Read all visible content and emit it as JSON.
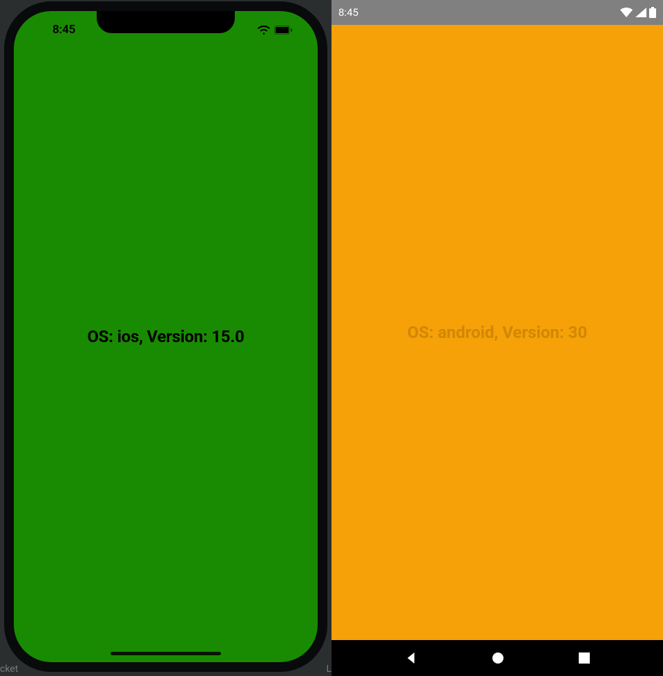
{
  "ios": {
    "status": {
      "time": "8:45"
    },
    "main_text": "OS: ios, Version: 15.0",
    "background_color": "#198b02",
    "icons": {
      "wifi": "wifi-icon",
      "battery": "battery-icon"
    }
  },
  "android": {
    "status": {
      "time": "8:45"
    },
    "main_text": "OS: android, Version: 30",
    "background_color": "#f5a107",
    "icons": {
      "wifi": "wifi-icon",
      "signal": "signal-icon",
      "battery": "battery-icon"
    },
    "nav": {
      "back": "back-icon",
      "home": "home-icon",
      "recent": "recent-icon"
    }
  },
  "cropped_bg": {
    "left": "cket",
    "right": "L"
  }
}
